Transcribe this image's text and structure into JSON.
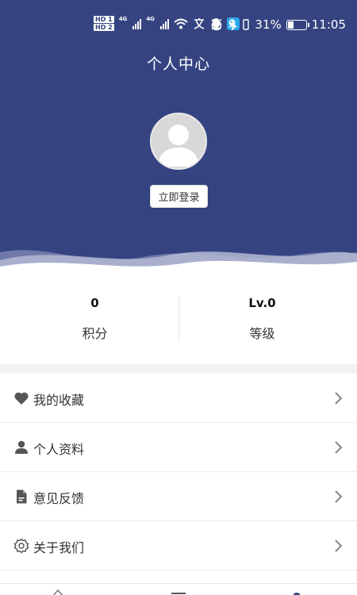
{
  "status_bar": {
    "hd1": "HD 1",
    "hd2": "HD 2",
    "net1": "4G",
    "net2": "4G",
    "battery_percent": "31%",
    "battery_level": 0.31,
    "time": "11:05"
  },
  "header": {
    "title": "个人中心",
    "login_button": "立即登录",
    "background_color": "#354481"
  },
  "stats": [
    {
      "value": "0",
      "label": "积分"
    },
    {
      "value": "Lv.0",
      "label": "等级"
    }
  ],
  "menu": [
    {
      "label": "我的收藏",
      "icon": "heart-icon"
    },
    {
      "label": "个人资料",
      "icon": "person-icon"
    },
    {
      "label": "意见反馈",
      "icon": "document-icon"
    },
    {
      "label": "关于我们",
      "icon": "gear-icon"
    }
  ],
  "tab_icons": [
    "home-icon",
    "list-icon",
    "profile-icon"
  ]
}
